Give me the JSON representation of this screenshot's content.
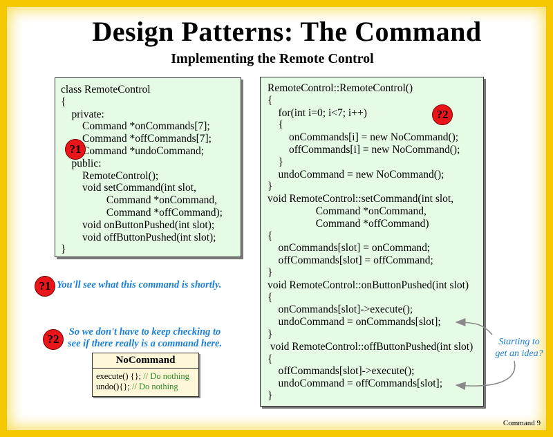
{
  "title": "Design Patterns: The Command",
  "subtitle": "Implementing the Remote Control",
  "left_code": [
    "class RemoteControl",
    "{",
    "    private:",
    "        Command *onCommands[7];",
    "        Command *offCommands[7];",
    "        Command *undoCommand;",
    "    public:",
    "        RemoteControl();",
    "        void setCommand(int slot,",
    "                 Command *onCommand,",
    "                 Command *offCommand);",
    "        void onButtonPushed(int slot);",
    "        void offButtonPushed(int slot);",
    "}"
  ],
  "right_code": [
    "RemoteControl::RemoteControl()",
    "{",
    "    for(int i=0; i<7; i++)",
    "    {",
    "        onCommands[i] = new NoCommand();",
    "        offCommands[i] = new NoCommand();",
    "    }",
    "    undoCommand = new NoCommand();",
    "}",
    "void RemoteControl::setCommand(int slot,",
    "                  Command *onCommand,",
    "                  Command *offCommand)",
    "{",
    "    onCommands[slot] = onCommand;",
    "    offCommands[slot] = offCommand;",
    "}",
    "void RemoteControl::onButtonPushed(int slot)",
    "{",
    "    onCommands[slot]->execute();",
    "    undoCommand = onCommands[slot];",
    "}",
    " void RemoteControl::offButtonPushed(int slot)",
    "{",
    "    offCommands[slot]->execute();",
    "    undoCommand = offCommands[slot];",
    "}"
  ],
  "badges": {
    "one": "?1",
    "two": "?2"
  },
  "notes": {
    "one": "You'll see what this command is shortly.",
    "two_line1": "So we don't have to keep checking to",
    "two_line2": "see if there really is a command here."
  },
  "nocommand": {
    "title": "NoCommand",
    "execute_code": "execute() {}; ",
    "execute_comment": "// Do nothing",
    "undo_code": "undo(){}; ",
    "undo_comment": "// Do nothing"
  },
  "hint": {
    "line1": "Starting to",
    "line2": "get an idea?"
  },
  "footer": "Command 9",
  "colors": {
    "frame": "#f6c800",
    "code_bg": "#e6fbe6",
    "badge": "#e8161b",
    "note": "#1b7fd6",
    "comment": "#2a8a2a"
  }
}
